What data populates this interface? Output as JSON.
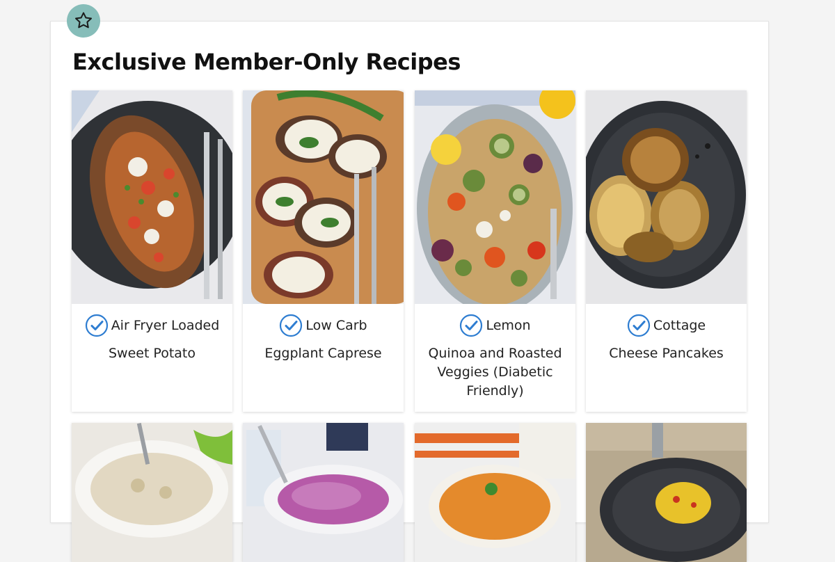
{
  "section": {
    "title": "Exclusive Member-Only Recipes"
  },
  "colors": {
    "badge": "#86bdb9",
    "check": "#2e7dd1"
  },
  "icons": {
    "badge": "star-icon",
    "check": "check-circle-icon"
  },
  "recipes": [
    {
      "line1": "Air Fryer Loaded",
      "rest": "Sweet Potato"
    },
    {
      "line1": "Low Carb",
      "rest": "Eggplant Caprese"
    },
    {
      "line1": "Lemon",
      "rest": "Quinoa and Roasted Veggies (Diabetic Friendly)"
    },
    {
      "line1": "Cottage",
      "rest": "Cheese Pancakes"
    }
  ]
}
